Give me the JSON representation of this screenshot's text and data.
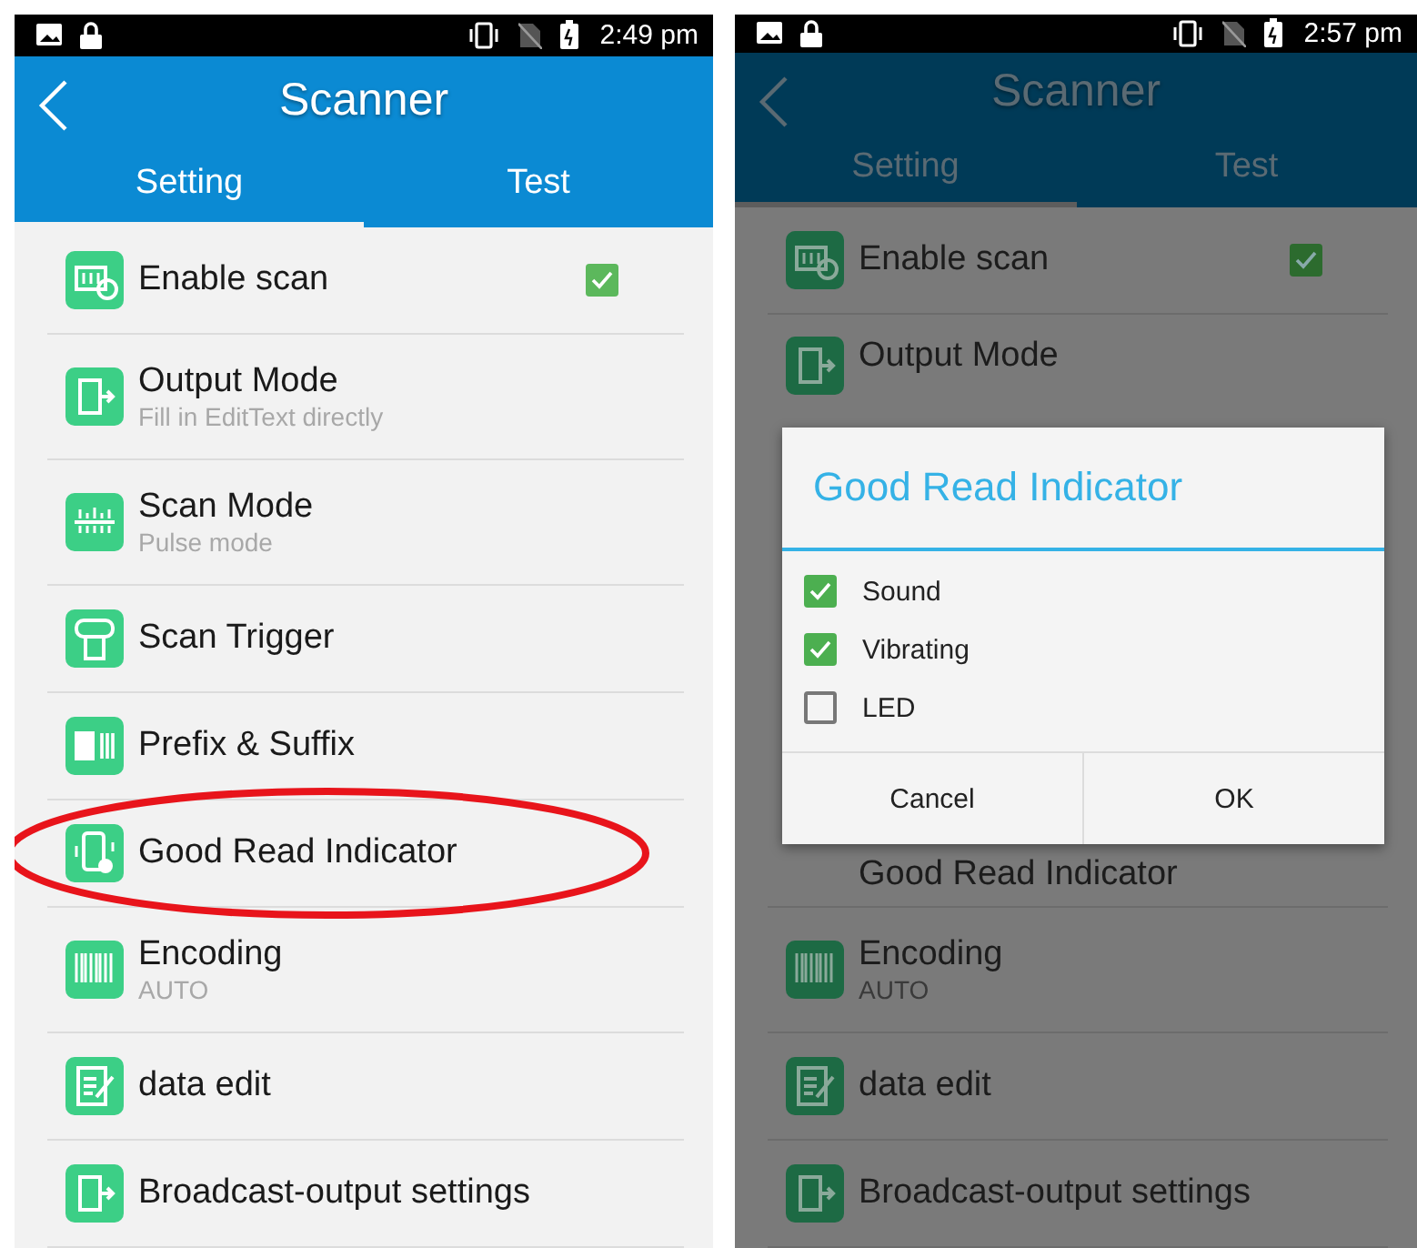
{
  "screens": [
    {
      "dimmed": false,
      "status_time": "2:49 pm",
      "title": "Scanner",
      "tabs": [
        {
          "label": "Setting",
          "selected": true
        },
        {
          "label": "Test",
          "selected": false
        }
      ],
      "items": [
        {
          "kind": "checkbox",
          "title": "Enable scan",
          "checked": true,
          "highlighted": false
        },
        {
          "kind": "subtitle",
          "title": "Output Mode",
          "subtitle": "Fill in EditText directly",
          "highlighted": false
        },
        {
          "kind": "subtitle",
          "title": "Scan Mode",
          "subtitle": "Pulse mode",
          "highlighted": false
        },
        {
          "kind": "plain",
          "title": "Scan Trigger",
          "highlighted": false
        },
        {
          "kind": "plain",
          "title": "Prefix & Suffix",
          "highlighted": false
        },
        {
          "kind": "plain",
          "title": "Good Read Indicator",
          "highlighted": true
        },
        {
          "kind": "subtitle",
          "title": "Encoding",
          "subtitle": "AUTO",
          "highlighted": false
        },
        {
          "kind": "plain",
          "title": "data edit",
          "highlighted": false
        },
        {
          "kind": "plain",
          "title": "Broadcast-output settings",
          "highlighted": false
        }
      ]
    },
    {
      "dimmed": true,
      "status_time": "2:57 pm",
      "title": "Scanner",
      "tabs": [
        {
          "label": "Setting",
          "selected": true
        },
        {
          "label": "Test",
          "selected": false
        }
      ],
      "items": [
        {
          "kind": "checkbox",
          "title": "Enable scan",
          "checked": true,
          "highlighted": false
        },
        {
          "kind": "partial",
          "title": "Output Mode",
          "highlighted": false
        },
        {
          "kind": "dialog"
        },
        {
          "kind": "partial",
          "title": "Good Read Indicator",
          "highlighted": false
        },
        {
          "kind": "subtitle",
          "title": "Encoding",
          "subtitle": "AUTO",
          "highlighted": false
        },
        {
          "kind": "plain",
          "title": "data edit",
          "highlighted": false
        },
        {
          "kind": "plain",
          "title": "Broadcast-output settings",
          "highlighted": false
        }
      ],
      "dialog": {
        "title": "Good Read Indicator",
        "options": [
          {
            "label": "Sound",
            "checked": true
          },
          {
            "label": "Vibrating",
            "checked": true
          },
          {
            "label": "LED",
            "checked": false
          }
        ],
        "buttons": [
          "Cancel",
          "OK"
        ]
      }
    }
  ]
}
